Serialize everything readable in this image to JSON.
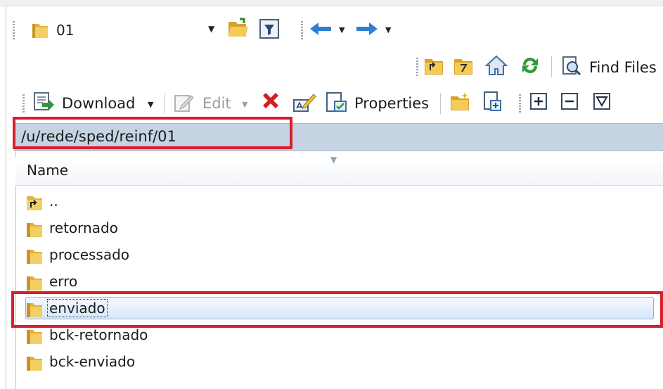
{
  "toolbar_top": {
    "path_combo_value": "01",
    "icons": [
      "open-folder-icon",
      "filter-icon",
      "back-arrow-icon",
      "forward-arrow-icon"
    ]
  },
  "toolbar_nav": {
    "find_files_label": "Find Files"
  },
  "toolbar_actions": {
    "download_label": "Download",
    "edit_label": "Edit",
    "properties_label": "Properties"
  },
  "address": {
    "path": "/u/rede/sped/reinf/01"
  },
  "list": {
    "column_name": "Name",
    "items": [
      {
        "name": "..",
        "type": "parent"
      },
      {
        "name": "retornado",
        "type": "folder"
      },
      {
        "name": "processado",
        "type": "folder"
      },
      {
        "name": "erro",
        "type": "folder"
      },
      {
        "name": "enviado",
        "type": "folder",
        "selected": true
      },
      {
        "name": "bck-retornado",
        "type": "folder"
      },
      {
        "name": "bck-enviado",
        "type": "folder"
      }
    ]
  },
  "colors": {
    "highlight_red": "#d7202b",
    "address_bar": "#c6d3e3",
    "selection": "#d7e7fa"
  }
}
